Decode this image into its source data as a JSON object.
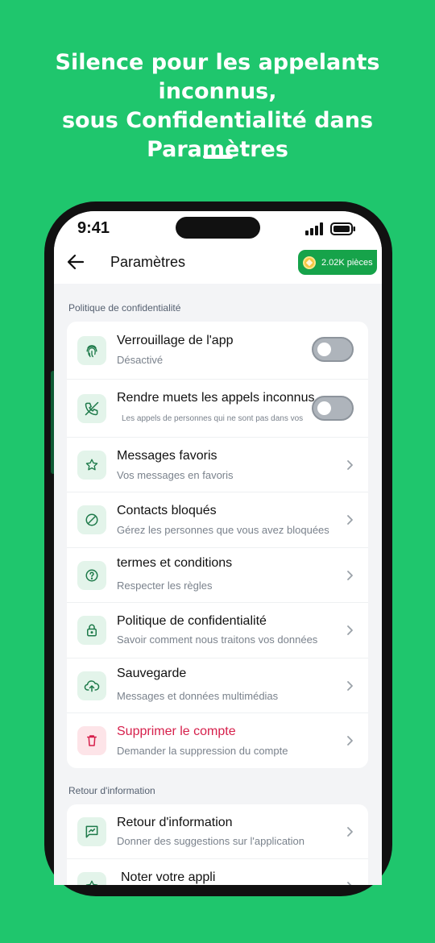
{
  "headline": {
    "line1": "Silence pour les appelants inconnus,",
    "line2": "sous Confidentialité dans",
    "line3": "Paramètres"
  },
  "status_bar": {
    "time": "9:41"
  },
  "header": {
    "title": "Paramètres",
    "coins_label": "2.02K pièces"
  },
  "sections": [
    {
      "label": "Politique de confidentialité",
      "items": [
        {
          "title": "Verrouillage de l'app",
          "subtitle": "Désactivé",
          "control": "toggle",
          "toggle_on": false,
          "icon": "fingerprint-icon"
        },
        {
          "title": "Rendre muets les appels inconnus",
          "subtitle": "Les appels de personnes qui ne sont pas dans vos",
          "control": "toggle",
          "toggle_on": false,
          "icon": "muted-phone-icon"
        },
        {
          "title": "Messages favoris",
          "subtitle": "Vos messages en favoris",
          "control": "chevron",
          "icon": "star-icon"
        },
        {
          "title": "Contacts bloqués",
          "subtitle": "Gérez les personnes que vous avez bloquées",
          "control": "chevron",
          "icon": "blocked-icon"
        },
        {
          "title": "termes et conditions",
          "subtitle": "Respecter les règles",
          "control": "chevron",
          "icon": "question-icon"
        },
        {
          "title": "Politique de confidentialité",
          "subtitle": "Savoir comment nous traitons vos données",
          "control": "chevron",
          "icon": "lock-icon"
        },
        {
          "title": "Sauvegarde",
          "subtitle": "Messages et données multimédias",
          "control": "chevron",
          "icon": "cloud-upload-icon"
        },
        {
          "title": "Supprimer le compte",
          "subtitle": "Demander la suppression du compte",
          "control": "chevron",
          "icon": "trash-icon",
          "danger": true
        }
      ]
    },
    {
      "label": "Retour d'information",
      "items": [
        {
          "title": "Retour d'information",
          "subtitle": "Donner des suggestions sur l'application",
          "control": "chevron",
          "icon": "feedback-icon"
        },
        {
          "title": "Noter votre appli",
          "subtitle": "",
          "control": "chevron",
          "icon": "rate-icon"
        }
      ]
    }
  ],
  "colors": {
    "background": "#1fc66d",
    "accent": "#1e7a4a",
    "coins_bg": "#16a34a",
    "danger": "#d61f4b"
  }
}
